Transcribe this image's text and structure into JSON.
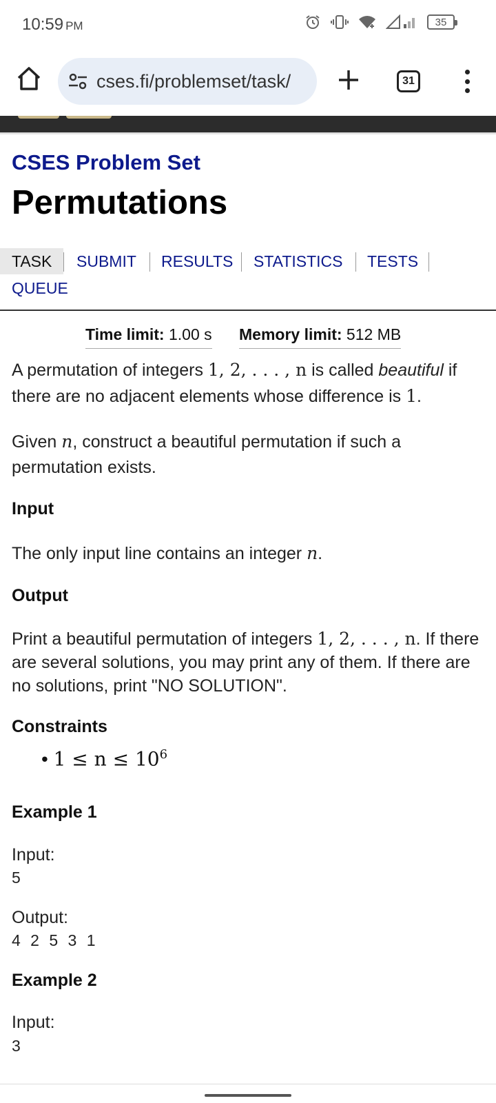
{
  "status_bar": {
    "time": "10:59",
    "ampm": "PM",
    "battery": "35"
  },
  "browser": {
    "url": "cses.fi/problemset/task/",
    "tab_count": "31"
  },
  "site_title": "CSES Problem Set",
  "page_title": "Permutations",
  "nav": {
    "task": "TASK",
    "submit": "SUBMIT",
    "results": "RESULTS",
    "statistics": "STATISTICS",
    "tests": "TESTS",
    "queue": "QUEUE"
  },
  "limits": {
    "time_label": "Time limit:",
    "time_value": "1.00 s",
    "memory_label": "Memory limit:",
    "memory_value": "512 MB"
  },
  "statement": {
    "p1_a": "A permutation of integers ",
    "p1_math": "1, 2, . . . , n",
    "p1_b": " is called ",
    "p1_em": "beautiful",
    "p1_c": " if there are no adjacent elements whose difference is ",
    "p1_math2": "1",
    "p1_d": ".",
    "p2_a": "Given ",
    "p2_math": "n",
    "p2_b": ", construct a beautiful permutation if such a permutation exists."
  },
  "input_section": {
    "heading": "Input",
    "text_a": "The only input line contains an integer ",
    "text_math": "n",
    "text_b": "."
  },
  "output_section": {
    "heading": "Output",
    "text_a": "Print a beautiful permutation of integers ",
    "text_math": "1, 2, . . . , n",
    "text_b": ". If there are several solutions, you may print any of them. If there are no solutions, print \"NO SOLUTION\"."
  },
  "constraints": {
    "heading": "Constraints",
    "item": "1 ≤ n ≤ 10",
    "exp": "6"
  },
  "example1": {
    "heading": "Example 1",
    "input_label": "Input:",
    "input_value": "5",
    "output_label": "Output:",
    "output_value": "4 2 5 3 1"
  },
  "example2": {
    "heading": "Example 2",
    "input_label": "Input:",
    "input_value": "3"
  }
}
